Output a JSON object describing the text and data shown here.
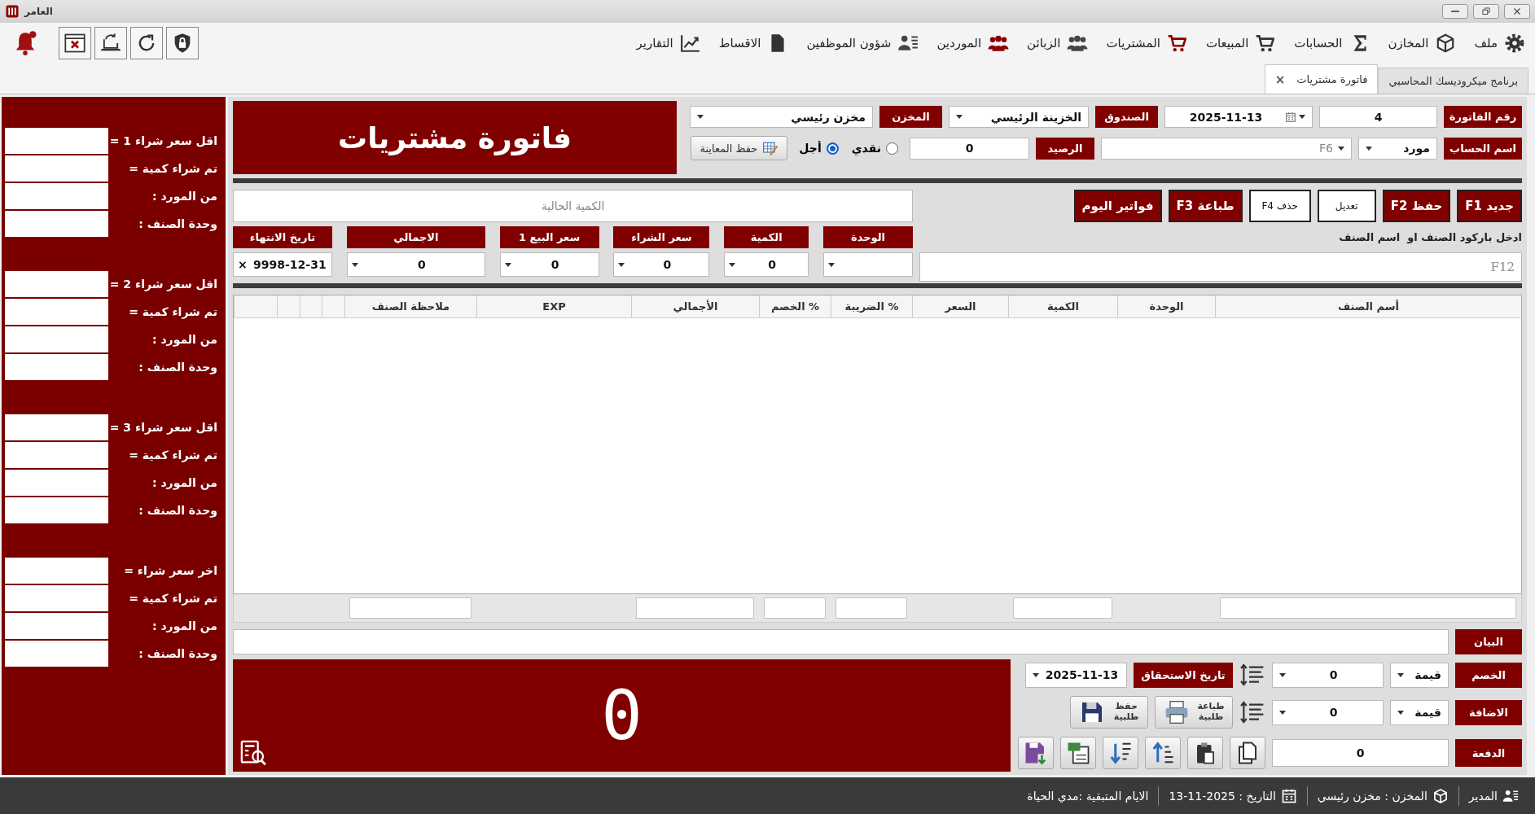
{
  "window": {
    "title": "العامر"
  },
  "menu": [
    {
      "label": "ملف"
    },
    {
      "label": "المخازن"
    },
    {
      "label": "الحسابات"
    },
    {
      "label": "المبيعات"
    },
    {
      "label": "المشتريات"
    },
    {
      "label": "الزبائن"
    },
    {
      "label": "الموردين"
    },
    {
      "label": "شؤون الموظفين"
    },
    {
      "label": "الاقساط"
    },
    {
      "label": "التقارير"
    }
  ],
  "tabs": [
    {
      "label": "برنامج ميكروديسك المحاسبي",
      "selected": false
    },
    {
      "label": "فاتورة مشتريات",
      "selected": true,
      "close": "×"
    }
  ],
  "header": {
    "title": "فاتورة مشتريات",
    "invoice_number": {
      "label": "رقم الفاتورة",
      "value": "4"
    },
    "date": {
      "value": "2025-11-13"
    },
    "cashbox": {
      "label": "الصندوق",
      "value": "الخزينة الرئيسي"
    },
    "store": {
      "label": "المخزن",
      "value": "مخزن رئيسي"
    },
    "account": {
      "label": "اسم الحساب",
      "type": "مورد",
      "placeholder": "F6"
    },
    "balance": {
      "label": "الرصيد",
      "value": "0"
    },
    "payment_modes": [
      {
        "label": "نقدي",
        "selected": false
      },
      {
        "label": "أجل",
        "selected": true
      }
    ],
    "save_preview": "حفظ المعاينة"
  },
  "actions": [
    {
      "label": "جديد F1",
      "disabled": false
    },
    {
      "label": "حفظ F2",
      "disabled": false
    },
    {
      "label": "تعديل",
      "disabled": true
    },
    {
      "label": "حذف F4",
      "disabled": true
    },
    {
      "label": "طباعة F3",
      "disabled": false
    },
    {
      "label": "فواتير اليوم",
      "disabled": false
    }
  ],
  "current_quantity": {
    "placeholder": "الكمية الحالية"
  },
  "barcode": {
    "label": "ادخل باركود الصنف او  اسم الصنف",
    "placeholder": "F12"
  },
  "entry_fields": [
    {
      "label": "الوحدة"
    },
    {
      "label": "الكمية",
      "value": "0"
    },
    {
      "label": "سعر الشراء",
      "value": "0"
    },
    {
      "label": "سعر البيع 1",
      "value": "0"
    },
    {
      "label": "الاجمالي",
      "value": "0"
    },
    {
      "label": "تاريخ الانتهاء",
      "value": "9998-12-31",
      "clear": "×"
    }
  ],
  "table": {
    "columns": [
      "أسم الصنف",
      "الوحدة",
      "الكمية",
      "السعر",
      "% الضريبة",
      "% الخصم",
      "الأجمالي",
      "EXP",
      "ملاحظة الصنف"
    ]
  },
  "notes": {
    "label": "البيان"
  },
  "discount": {
    "label": "الخصم",
    "type": "قيمة",
    "value": "0"
  },
  "addition": {
    "label": "الاضافة",
    "type": "قيمة",
    "value": "0"
  },
  "payment": {
    "label": "الدفعة",
    "value": "0"
  },
  "due_date": {
    "label": "تاريخ الاستحقاق",
    "value": "2025-11-13"
  },
  "order_buttons": [
    "طباعة طلبية",
    "حفظ طلبية"
  ],
  "display": {
    "value": "0"
  },
  "side_panel": {
    "groups": [
      {
        "rows": [
          "اقل سعر شراء 1 =",
          "تم شراء كمية =",
          "من المورد :",
          "وحدة الصنف :"
        ]
      },
      {
        "rows": [
          "اقل سعر شراء 2 =",
          "تم شراء كمية =",
          "من المورد :",
          "وحدة الصنف :"
        ]
      },
      {
        "rows": [
          "اقل سعر شراء 3 =",
          "تم شراء كمية =",
          "من المورد :",
          "وحدة الصنف :"
        ]
      },
      {
        "rows": [
          "اخر سعر شراء =",
          "تم شراء كمية =",
          "من المورد :",
          "وحدة الصنف :"
        ]
      }
    ]
  },
  "status_bar": {
    "user": "المدير",
    "store": "المخزن : مخزن رئيسي",
    "date": "التاريخ : 2025-11-13",
    "remaining": "الايام المتبقية :مدي الحياة"
  }
}
